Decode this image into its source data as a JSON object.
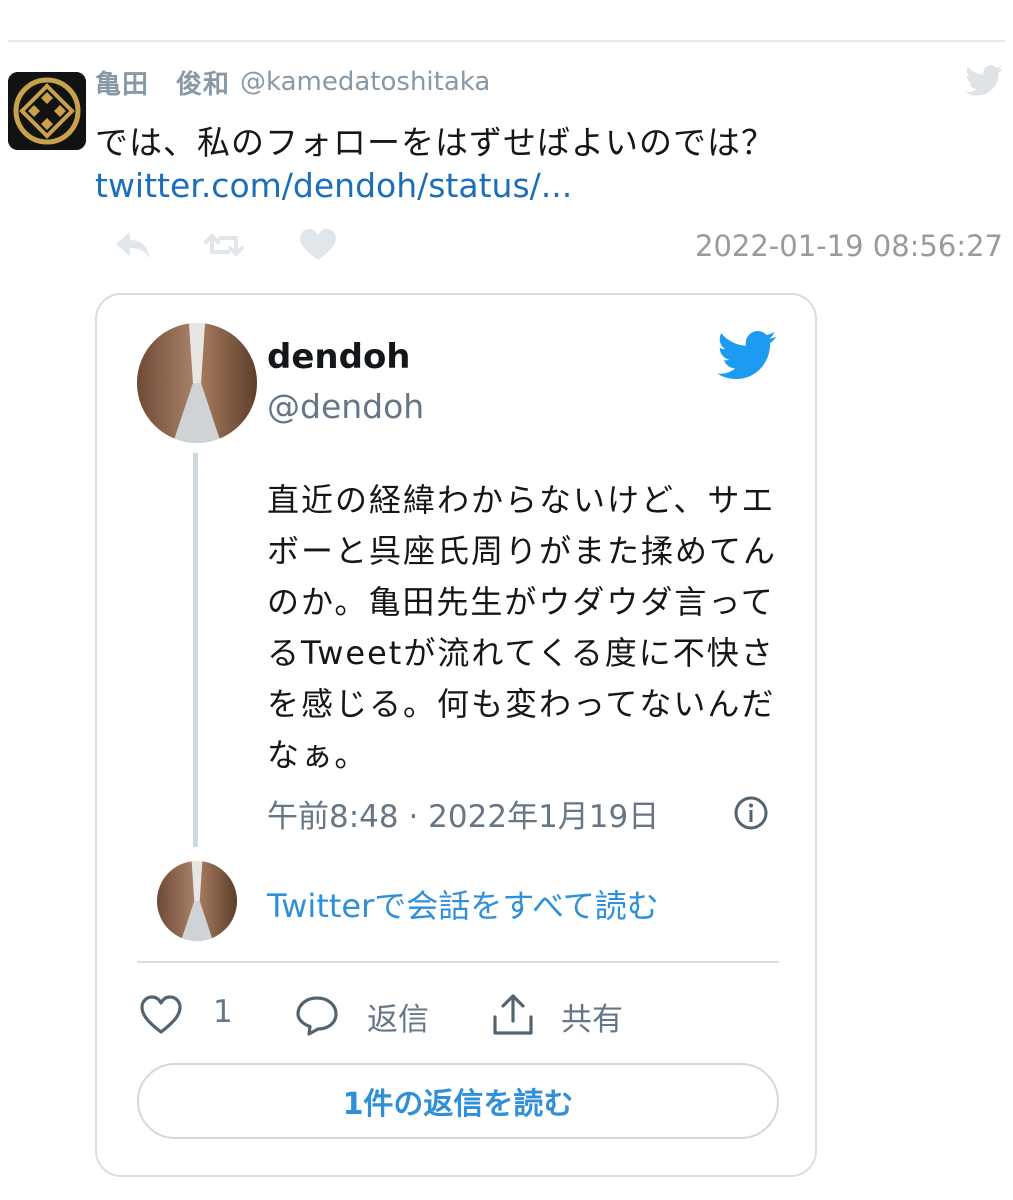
{
  "tweet": {
    "author_name": "亀田　俊和",
    "author_handle": "@kamedatoshitaka",
    "text": "では、私のフォローをはずせばよいのでは？",
    "link": "twitter.com/dendoh/status/...",
    "timestamp": "2022-01-19 08:56:27",
    "icons": [
      "reply-icon",
      "retweet-icon",
      "like-icon",
      "twitter-bird-icon"
    ]
  },
  "embedded": {
    "author_name": "dendoh",
    "author_handle": "@dendoh",
    "text": "直近の経緯わからないけど、サエボーと呉座氏周りがまた揉めてんのか。亀田先生がウダウダ言ってるTweetが流れてくる度に不快さを感じる。何も変わってないんだなぁ。",
    "meta": "午前8:48 · 2022年1月19日",
    "read_conversation": "Twitterで会話をすべて読む",
    "like_count": "1",
    "reply_label": "返信",
    "share_label": "共有",
    "read_replies_button": "1件の返信を読む"
  },
  "colors": {
    "link_blue": "#1b6fb8",
    "accent_blue": "#2f8fd8",
    "twitter_blue": "#1d9bf0",
    "muted_gray": "#8899a6",
    "border_gray": "#d8dde2",
    "avatar_gold": "#c8a24a"
  }
}
